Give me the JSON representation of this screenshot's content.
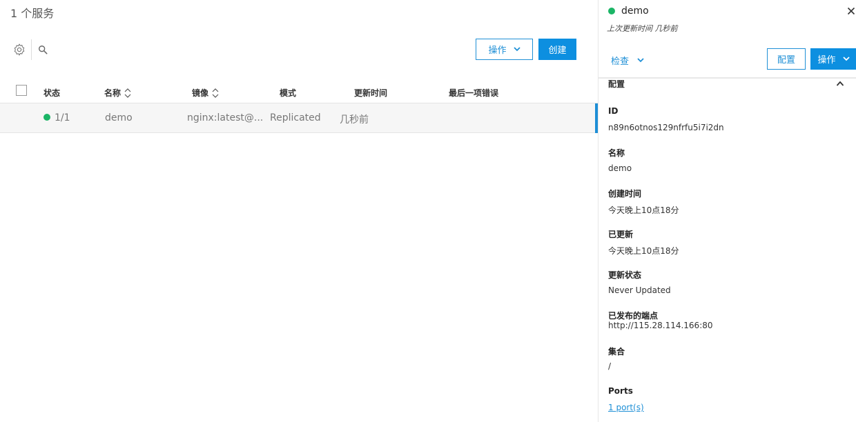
{
  "list": {
    "title": "1 个服务",
    "actions_label": "操作",
    "create_label": "创建",
    "columns": {
      "status": "状态",
      "name": "名称",
      "image": "镜像",
      "mode": "模式",
      "updated": "更新时间",
      "last_error": "最后一项错误"
    },
    "rows": [
      {
        "status": "1/1",
        "name": "demo",
        "image": "nginx:latest@...",
        "mode": "Replicated",
        "updated": "几秒前",
        "last_error": ""
      }
    ]
  },
  "panel": {
    "service_name": "demo",
    "last_updated": "上次更新时间 几秒前",
    "inspect_label": "检查",
    "config_label": "配置",
    "actions_label": "操作",
    "section_title": "配置",
    "fields": {
      "id_label": "ID",
      "id_value": "n89n6otnos129nfrfu5i7i2dn",
      "name_label": "名称",
      "name_value": "demo",
      "created_label": "创建时间",
      "created_value": "今天晚上10点18分",
      "modified_label": "已更新",
      "modified_value": "今天晚上10点18分",
      "update_status_label": "更新状态",
      "update_status_value": "Never Updated",
      "endpoints_label": "已发布的端点",
      "endpoints_value": "http://115.28.114.166:80",
      "stack_label": "集合",
      "stack_value": "/",
      "ports_label": "Ports",
      "ports_value": "1 port(s)"
    }
  },
  "colors": {
    "accent": "#1e8fd6",
    "primary_button": "#0d8fe0",
    "status_running": "#1bb566",
    "row_selected": "#f6f6f6"
  },
  "icons": [
    "gear-icon",
    "search-icon",
    "chevron-down-icon",
    "sort-icon",
    "close-icon",
    "chevron-up-icon"
  ]
}
